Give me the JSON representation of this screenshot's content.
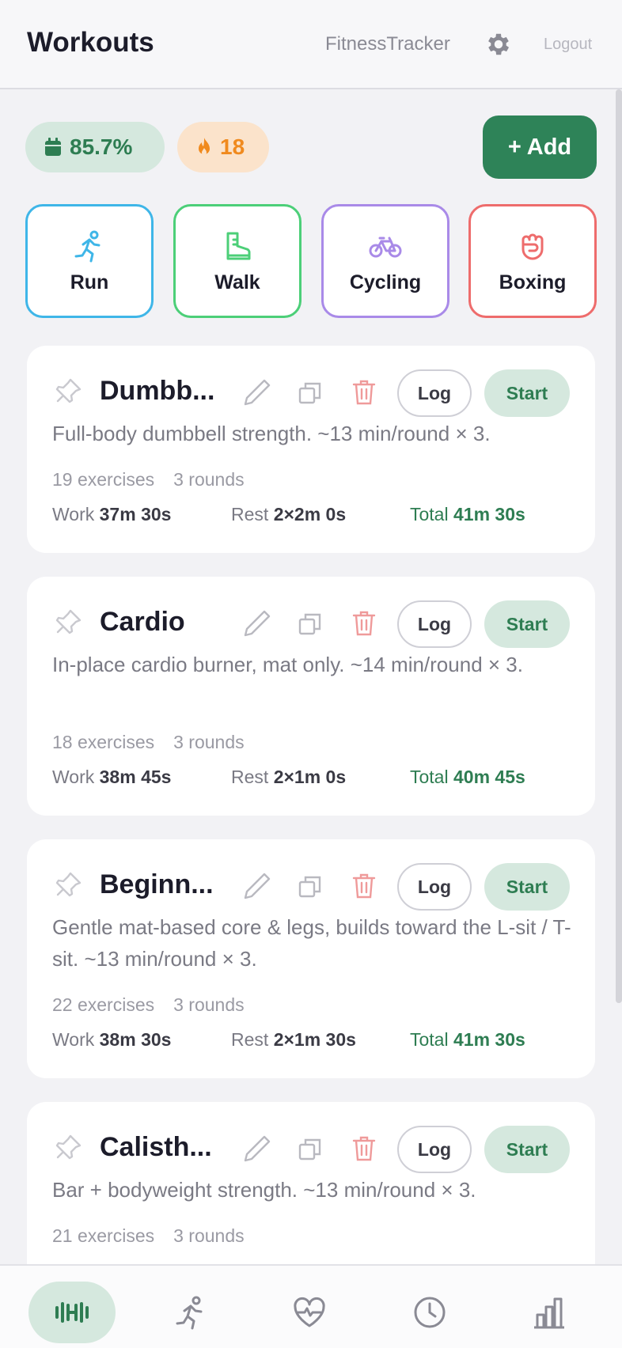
{
  "header": {
    "title": "Workouts",
    "brand": "FitnessTracker",
    "settings_icon": "gear-icon",
    "logout_label": "Logout"
  },
  "summary": {
    "success_rate": "85.7%",
    "streak": "18",
    "add_label": "+ Add"
  },
  "categories": [
    {
      "label": "Run",
      "icon": "running-person-icon",
      "color": "#3fb6e8"
    },
    {
      "label": "Walk",
      "icon": "boot-icon",
      "color": "#4ccf78"
    },
    {
      "label": "Cycling",
      "icon": "bicycle-icon",
      "color": "#a98ae8"
    },
    {
      "label": "Boxing",
      "icon": "boxing-fist-icon",
      "color": "#ee6c6c"
    }
  ],
  "workouts": [
    {
      "name": "Dumbb...",
      "description": "Full-body dumbbell strength. ~13 min/round × 3.",
      "exercises": "19 exercises",
      "rounds": "3 rounds",
      "work_label": "Work",
      "work": "37m 30s",
      "rest_label": "Rest",
      "rest": "2×2m 0s",
      "total_label": "Total",
      "total": "41m 30s",
      "log_label": "Log",
      "start_label": "Start"
    },
    {
      "name": "Cardio",
      "description": "In-place cardio burner, mat only. ~14 min/round × 3.",
      "exercises": "18 exercises",
      "rounds": "3 rounds",
      "work_label": "Work",
      "work": "38m 45s",
      "rest_label": "Rest",
      "rest": "2×1m 0s",
      "total_label": "Total",
      "total": "40m 45s",
      "log_label": "Log",
      "start_label": "Start"
    },
    {
      "name": "Beginn...",
      "description": "Gentle mat-based core & legs, builds toward the L-sit / T-sit. ~13 min/round × 3.",
      "exercises": "22 exercises",
      "rounds": "3 rounds",
      "work_label": "Work",
      "work": "38m 30s",
      "rest_label": "Rest",
      "rest": "2×1m 30s",
      "total_label": "Total",
      "total": "41m 30s",
      "log_label": "Log",
      "start_label": "Start"
    },
    {
      "name": "Calisth...",
      "description": "Bar + bodyweight strength. ~13 min/round × 3.",
      "exercises": "21 exercises",
      "rounds": "3 rounds",
      "log_label": "Log",
      "start_label": "Start"
    }
  ],
  "bottom_nav": [
    {
      "icon": "dumbbell-icon",
      "active": true
    },
    {
      "icon": "running-person-icon",
      "active": false
    },
    {
      "icon": "heart-pulse-icon",
      "active": false
    },
    {
      "icon": "clock-icon",
      "active": false
    },
    {
      "icon": "bar-chart-icon",
      "active": false
    }
  ],
  "colors": {
    "accent": "#2e8358",
    "accent_soft": "#d5e8de",
    "streak": "#f08a1e",
    "delete": "#ef9a9a"
  }
}
